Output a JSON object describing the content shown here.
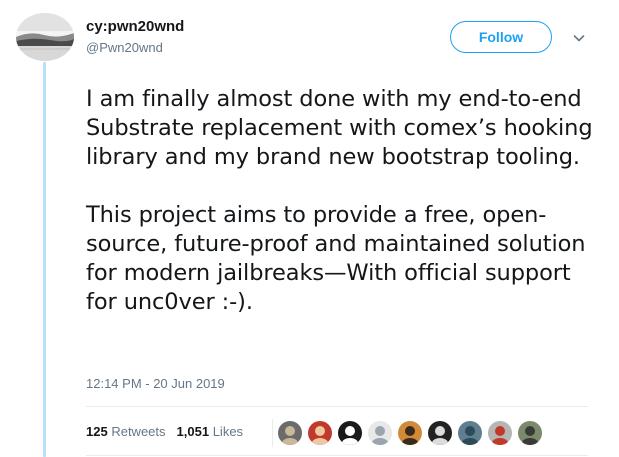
{
  "author": {
    "display_name": "cy:pwn20wnd",
    "handle": "@Pwn20wnd",
    "avatar_icon": "landscape-avatar"
  },
  "header": {
    "follow_label": "Follow",
    "more_icon": "chevron-down-icon"
  },
  "tweet": {
    "paragraphs": [
      "I am finally almost done with my end-to-end Substrate replacement with comex’s hooking library and my brand new bootstrap tooling.",
      "This project aims to provide a free, open-source, future-proof and maintained solution for modern jailbreaks—With official support for unc0ver :-)."
    ],
    "timestamp": "12:14 PM - 20 Jun 2019"
  },
  "stats": {
    "retweets_count": "125",
    "retweets_label": "Retweets",
    "likes_count": "1,051",
    "likes_label": "Likes"
  },
  "likers": [
    {
      "name": "liker-avatar-1",
      "color": "#6b6b6b",
      "accent": "#c9b89a"
    },
    {
      "name": "liker-avatar-2",
      "color": "#c0392b",
      "accent": "#f0c8a0"
    },
    {
      "name": "liker-avatar-3",
      "color": "#1a1a1a",
      "accent": "#ffffff"
    },
    {
      "name": "liker-avatar-4",
      "color": "#e8e8e8",
      "accent": "#9aa5b0"
    },
    {
      "name": "liker-avatar-5",
      "color": "#d08a3a",
      "accent": "#3a2a1a"
    },
    {
      "name": "liker-avatar-6",
      "color": "#222222",
      "accent": "#dcdcdc"
    },
    {
      "name": "liker-avatar-7",
      "color": "#5f7f8f",
      "accent": "#2c4a58"
    },
    {
      "name": "liker-avatar-8",
      "color": "#b5b5b5",
      "accent": "#c0392b"
    },
    {
      "name": "liker-avatar-9",
      "color": "#7a8a6a",
      "accent": "#3a3a3a"
    }
  ],
  "colors": {
    "accent": "#1da1f2",
    "thread_line": "#b8dff7",
    "secondary_text": "#657786",
    "primary_text": "#14171a"
  }
}
